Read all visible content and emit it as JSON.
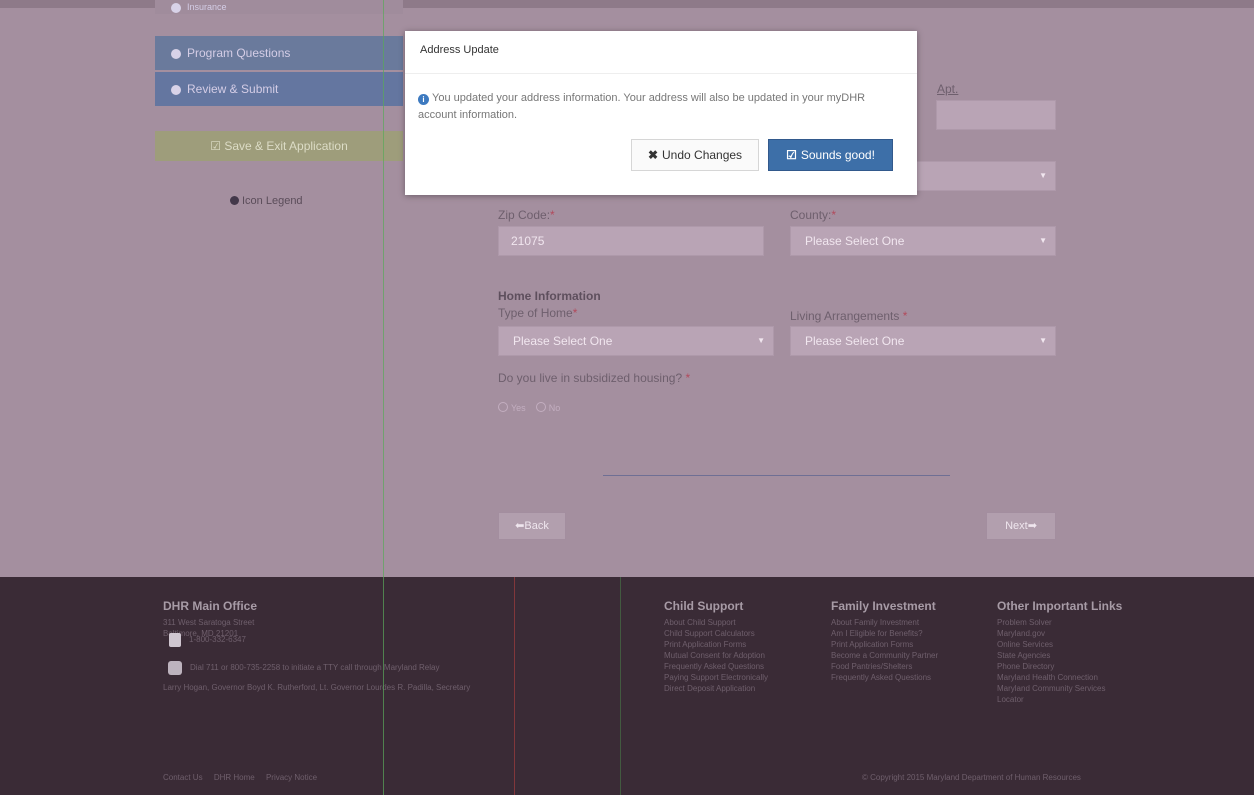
{
  "sidebar": {
    "items": [
      {
        "label": "Insurance"
      },
      {
        "label": "Program Questions"
      },
      {
        "label": "Review & Submit"
      }
    ],
    "save_label": "Save & Exit Application",
    "legend_label": "Icon Legend"
  },
  "form": {
    "apt_label": "Apt.",
    "zip_label": "Zip Code:",
    "zip_value": "21075",
    "county_label": "County:",
    "county_value": "Please Select One",
    "home_section": "Home Information",
    "type_home_label": "Type of Home",
    "type_home_value": "Please Select One",
    "living_label": "Living Arrangements",
    "living_value": "Please Select One",
    "subsidized_label": "Do you live in subsidized housing?",
    "radio_yes": "Yes",
    "radio_no": "No",
    "required_mark": "*",
    "back_label": "Back",
    "next_label": "Next"
  },
  "modal": {
    "title": "Address Update",
    "message": "You updated your address information. Your address will also be updated in your myDHR account information.",
    "undo_label": "Undo Changes",
    "confirm_label": "Sounds good!"
  },
  "footer": {
    "main_office": {
      "heading": "DHR Main Office",
      "address1": "311 West Saratoga Street",
      "address2": "Baltimore, MD 21201",
      "phone": "1-800-332-6347",
      "relay": "Dial 711 or 800-735-2258 to initiate a TTY call through Maryland Relay",
      "officials": "Larry Hogan, Governor  Boyd K. Rutherford, Lt. Governor  Lourdes R. Padilla, Secretary"
    },
    "child_support": {
      "heading": "Child Support",
      "items": [
        "About Child Support",
        "Child Support Calculators",
        "Print Application Forms",
        "Mutual Consent for Adoption",
        "Frequently Asked Questions",
        "Paying Support Electronically",
        "Direct Deposit Application"
      ]
    },
    "family_investment": {
      "heading": "Family Investment",
      "items": [
        "About Family Investment",
        "Am I Eligible for Benefits?",
        "Print Application Forms",
        "Become a Community Partner",
        "Food Pantries/Shelters",
        "Frequently Asked Questions"
      ]
    },
    "other_links": {
      "heading": "Other Important Links",
      "items": [
        "Problem Solver",
        "Maryland.gov",
        "Online Services",
        "State Agencies",
        "Phone Directory",
        "Maryland Health Connection",
        "Maryland Community Services",
        "Locator"
      ]
    },
    "bottom_links": [
      "Contact Us",
      "DHR Home",
      "Privacy Notice"
    ],
    "copyright": "© Copyright 2015 Maryland Department of Human Resources"
  },
  "colors": {
    "overlay_page": "#a48f9f",
    "footer_bg": "#3a2b36",
    "modal_primary": "#3d6fa8",
    "info_icon": "#3d7ac0"
  }
}
